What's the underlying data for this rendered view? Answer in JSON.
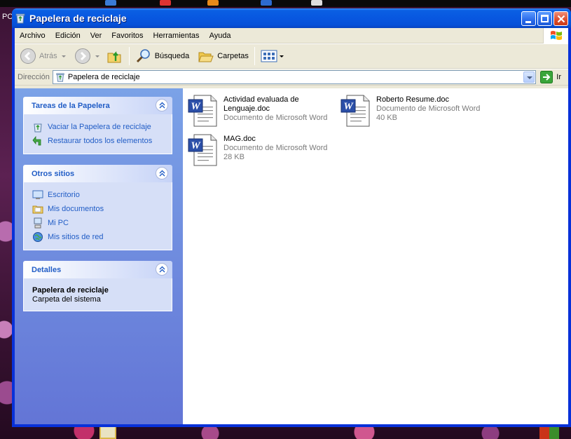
{
  "desktop": {
    "partial_label": "PC"
  },
  "window": {
    "title": "Papelera de reciclaje"
  },
  "menu": {
    "items": [
      "Archivo",
      "Edición",
      "Ver",
      "Favoritos",
      "Herramientas",
      "Ayuda"
    ]
  },
  "toolbar": {
    "back_label": "Atrás",
    "search_label": "Búsqueda",
    "folders_label": "Carpetas"
  },
  "address": {
    "label": "Dirección",
    "value": "Papelera de reciclaje",
    "go_label": "Ir"
  },
  "tasks": {
    "title": "Tareas de la Papelera",
    "items": [
      "Vaciar la Papelera de reciclaje",
      "Restaurar todos los elementos"
    ]
  },
  "other_places": {
    "title": "Otros sitios",
    "items": [
      "Escritorio",
      "Mis documentos",
      "Mi PC",
      "Mis sitios de red"
    ]
  },
  "details": {
    "title": "Detalles",
    "name": "Papelera de reciclaje",
    "subtitle": "Carpeta del sistema"
  },
  "files": [
    {
      "name_line1": "Actividad evaluada de",
      "name_line2": "Lenguaje.doc",
      "type": "Documento de Microsoft Word",
      "size": ""
    },
    {
      "name_line1": "Roberto Resume.doc",
      "name_line2": "",
      "type": "Documento de Microsoft Word",
      "size": "40 KB"
    },
    {
      "name_line1": "MAG.doc",
      "name_line2": "",
      "type": "Documento de Microsoft Word",
      "size": "28 KB"
    }
  ],
  "colors": {
    "titlebar": "#0a5fe3",
    "taskpane_link": "#215dc6",
    "taskpane_bg": "#7ba2e7"
  }
}
